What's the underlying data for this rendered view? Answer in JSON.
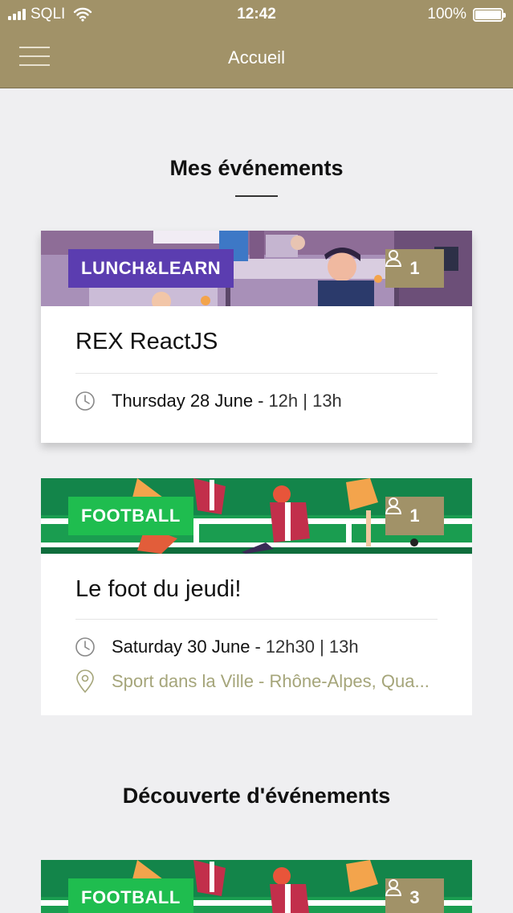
{
  "status_bar": {
    "carrier": "SQLI",
    "time": "12:42",
    "battery": "100%"
  },
  "nav": {
    "title": "Accueil",
    "menu_icon": "hamburger-icon"
  },
  "sections": {
    "my_events_title": "Mes événements",
    "discover_title": "Découverte d'événements"
  },
  "events": [
    {
      "category": "LUNCH&LEARN",
      "category_color": "#5b3db0",
      "attendees": "1",
      "title": "REX ReactJS",
      "date": "Thursday 28 June",
      "separator": "-",
      "hours": "12h | 13h"
    },
    {
      "category": "FOOTBALL",
      "category_color": "#1fbd4f",
      "attendees": "1",
      "title": "Le foot du jeudi!",
      "date": "Saturday 30 June",
      "separator": "-",
      "hours": "12h30 | 13h",
      "location": "Sport dans la Ville - Rhône-Alpes, Qua..."
    },
    {
      "category": "FOOTBALL",
      "category_color": "#1fbd4f",
      "attendees": "3"
    }
  ],
  "colors": {
    "header": "#a19268",
    "background": "#efeff1",
    "badge": "#a19268",
    "location_text": "#a5a57a"
  }
}
